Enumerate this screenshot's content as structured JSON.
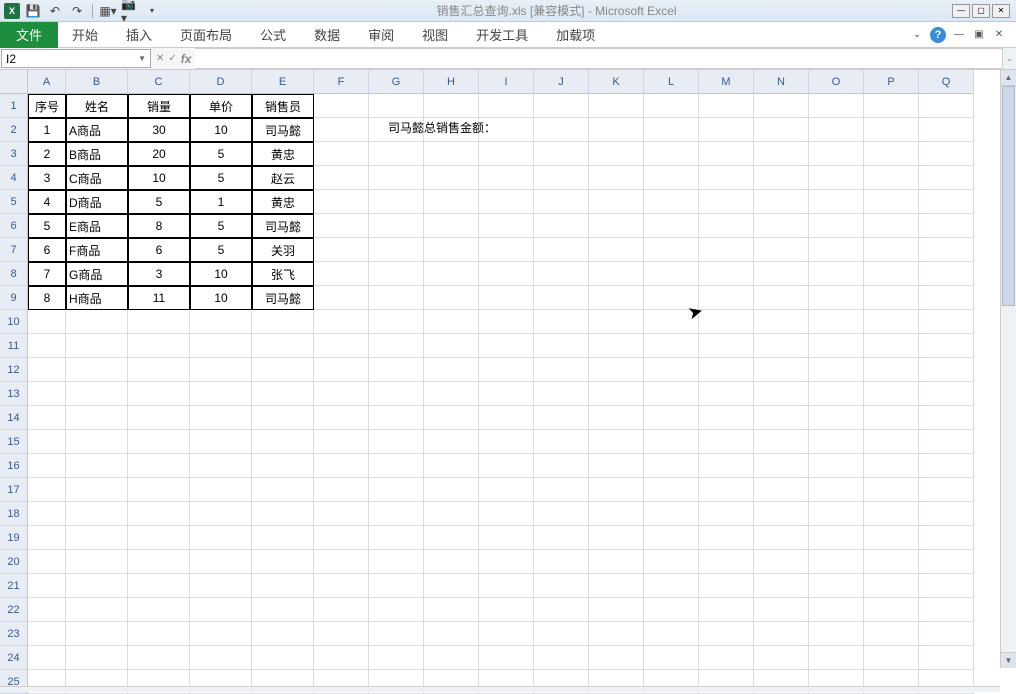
{
  "title": "销售汇总查询.xls  [兼容模式] - Microsoft Excel",
  "namebox": "I2",
  "formula": "",
  "tabs": {
    "file": "文件",
    "t1": "开始",
    "t2": "插入",
    "t3": "页面布局",
    "t4": "公式",
    "t5": "数据",
    "t6": "审阅",
    "t7": "视图",
    "t8": "开发工具",
    "t9": "加载项"
  },
  "cols": [
    "A",
    "B",
    "C",
    "D",
    "E",
    "F",
    "G",
    "H",
    "I",
    "J",
    "K",
    "L",
    "M",
    "N",
    "O",
    "P",
    "Q"
  ],
  "rows": [
    "1",
    "2",
    "3",
    "4",
    "5",
    "6",
    "7",
    "8",
    "9",
    "10",
    "11",
    "12",
    "13",
    "14",
    "15",
    "16",
    "17",
    "18",
    "19",
    "20",
    "21",
    "22",
    "23",
    "24",
    "25"
  ],
  "headers": {
    "a": "序号",
    "b": "姓名",
    "c": "销量",
    "d": "单价",
    "e": "销售员"
  },
  "data": [
    {
      "n": "1",
      "name": "A商品",
      "qty": "30",
      "price": "10",
      "sales": "司马懿"
    },
    {
      "n": "2",
      "name": "B商品",
      "qty": "20",
      "price": "5",
      "sales": "黄忠"
    },
    {
      "n": "3",
      "name": "C商品",
      "qty": "10",
      "price": "5",
      "sales": "赵云"
    },
    {
      "n": "4",
      "name": "D商品",
      "qty": "5",
      "price": "1",
      "sales": "黄忠"
    },
    {
      "n": "5",
      "name": "E商品",
      "qty": "8",
      "price": "5",
      "sales": "司马懿"
    },
    {
      "n": "6",
      "name": "F商品",
      "qty": "6",
      "price": "5",
      "sales": "关羽"
    },
    {
      "n": "7",
      "name": "G商品",
      "qty": "3",
      "price": "10",
      "sales": "张飞"
    },
    {
      "n": "8",
      "name": "H商品",
      "qty": "11",
      "price": "10",
      "sales": "司马懿"
    }
  ],
  "note": "司马懿总销售金额："
}
